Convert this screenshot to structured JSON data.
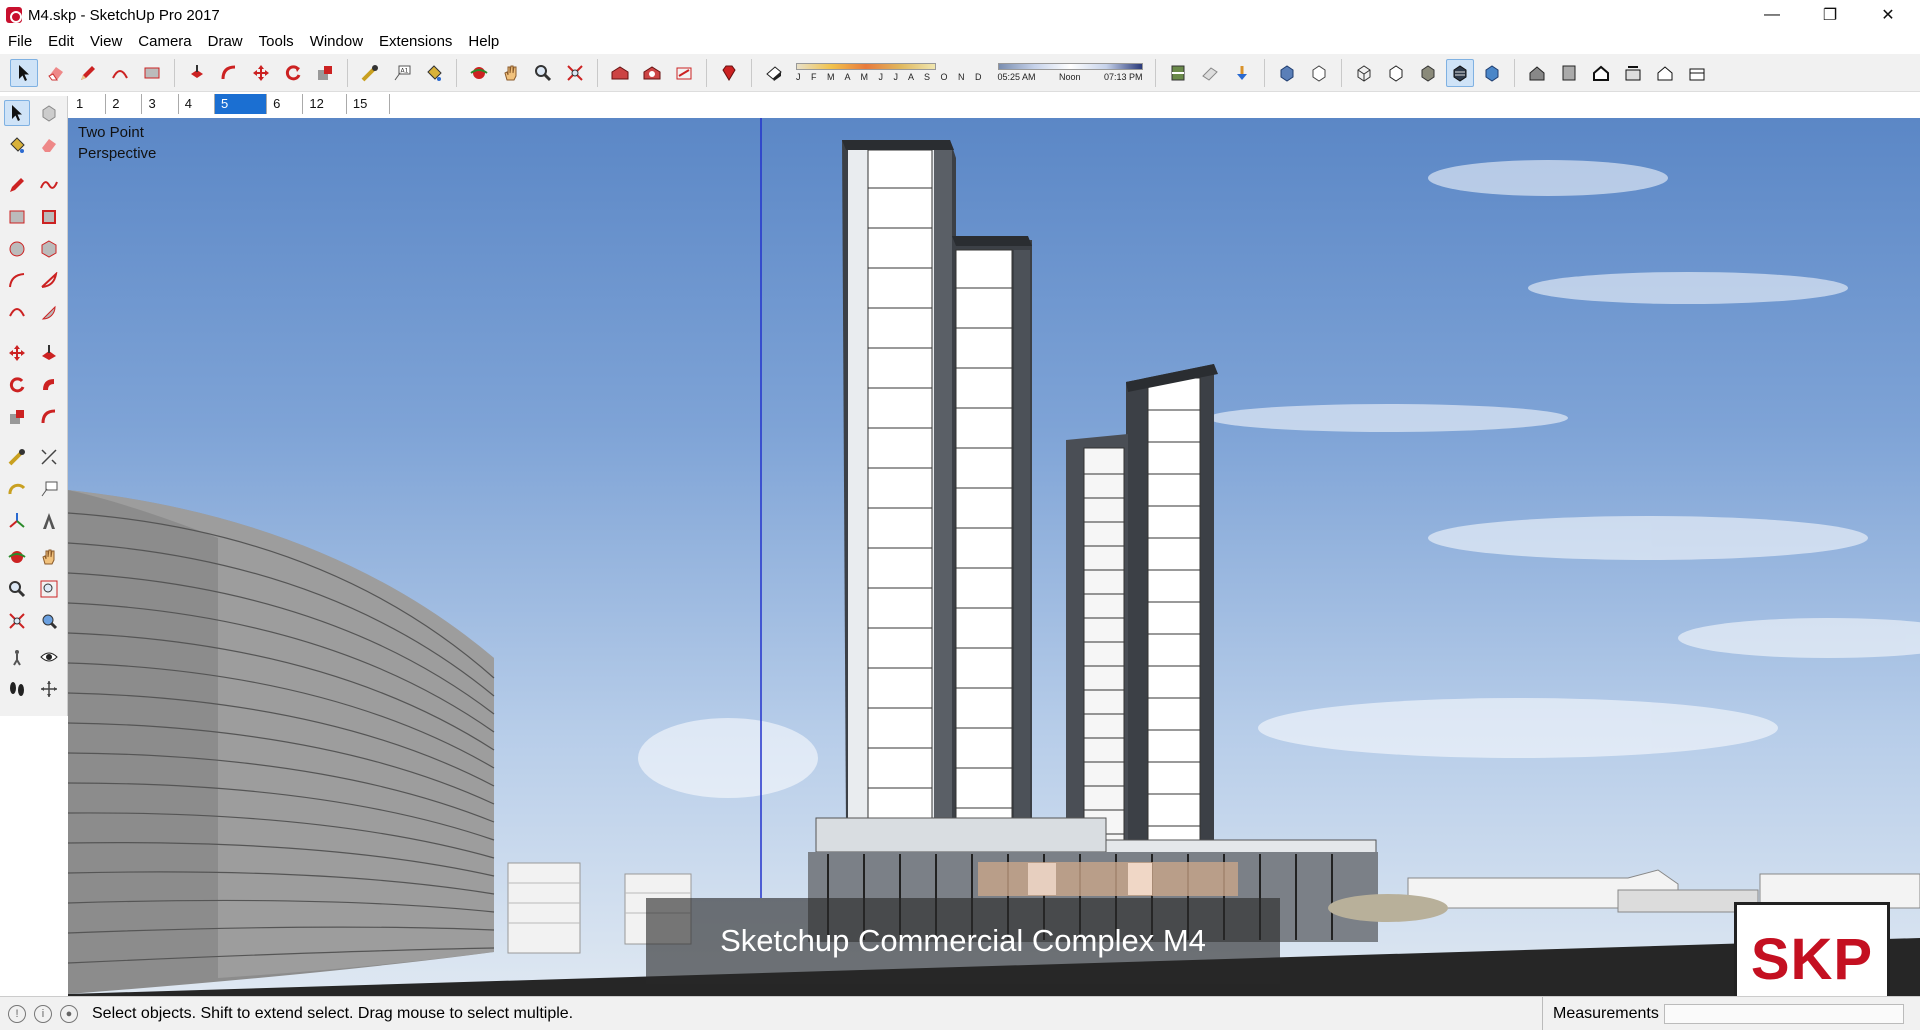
{
  "window": {
    "title": "M4.skp - SketchUp Pro 2017",
    "controls": {
      "minimize": "—",
      "restore": "❐",
      "close": "✕"
    }
  },
  "menu": [
    "File",
    "Edit",
    "View",
    "Camera",
    "Draw",
    "Tools",
    "Window",
    "Extensions",
    "Help"
  ],
  "shadow_settings": {
    "months": "J F M A M J J A S O N D",
    "time_start": "05:25 AM",
    "time_mid": "Noon",
    "time_end": "07:13 PM"
  },
  "scene_tabs": [
    "1",
    "2",
    "3",
    "4",
    "5",
    "6",
    "12",
    "15"
  ],
  "active_scene": "5",
  "viewport": {
    "camera_label_line1": "Two Point",
    "camera_label_line2": "Perspective",
    "caption": "Sketchup Commercial Complex M4",
    "logo": "SKP"
  },
  "status": {
    "message": "Select objects. Shift to extend select. Drag mouse to select multiple.",
    "measurements_label": "Measurements",
    "measurements_value": ""
  },
  "colors": {
    "accent": "#1b6fd2",
    "brand_red": "#c41021",
    "sky_top": "#5b87c6",
    "sky_bottom": "#dfe8f2"
  }
}
